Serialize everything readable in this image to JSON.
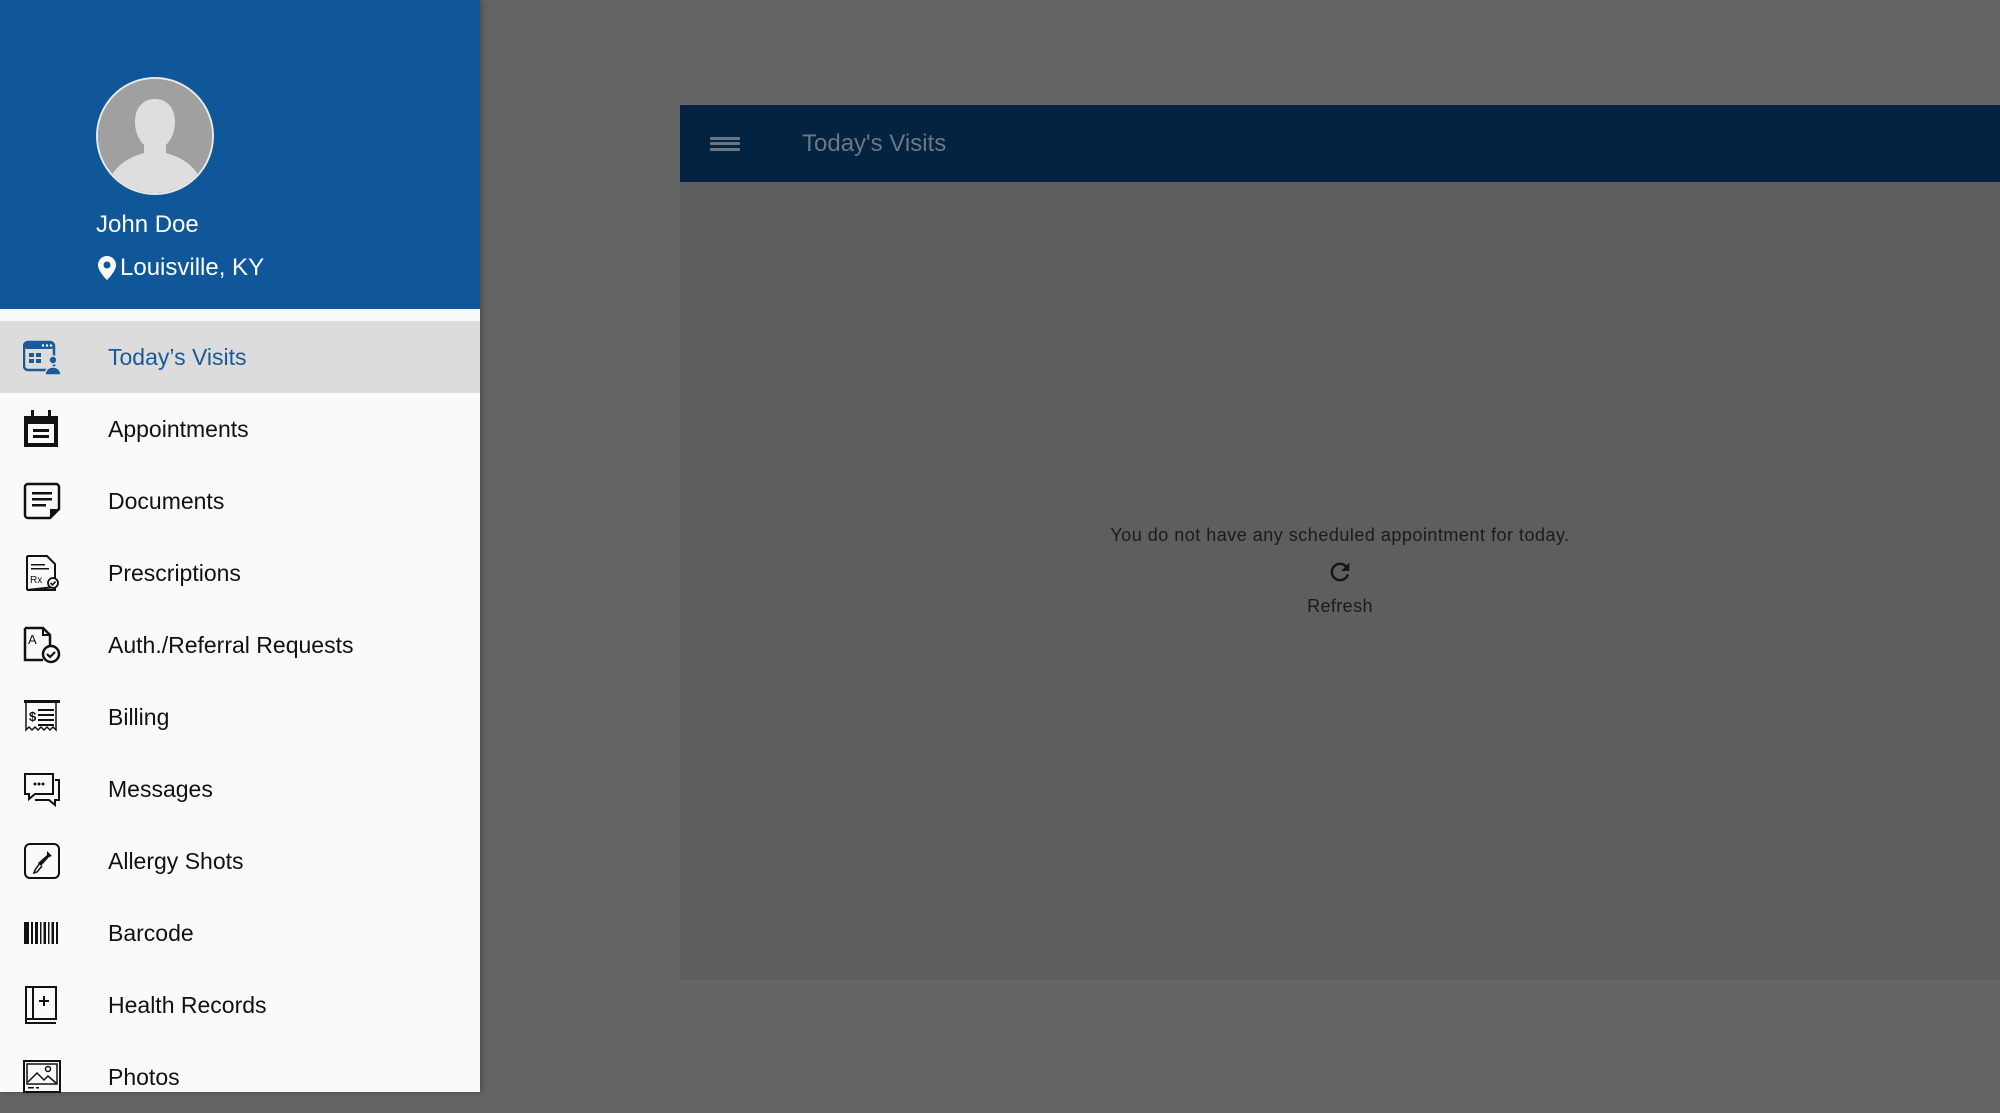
{
  "app_bar": {
    "title": "Today's Visits",
    "menu_icon": "hamburger-menu-icon"
  },
  "user": {
    "name": "John Doe",
    "location": "Louisville, KY",
    "avatar_icon": "default-user-avatar",
    "location_icon": "map-pin-icon"
  },
  "nav": {
    "items": [
      {
        "label": "Today’s Visits",
        "icon": "calendar-user-icon",
        "selected": true
      },
      {
        "label": "Appointments",
        "icon": "calendar-icon",
        "selected": false
      },
      {
        "label": "Documents",
        "icon": "document-icon",
        "selected": false
      },
      {
        "label": "Prescriptions",
        "icon": "prescription-icon",
        "selected": false
      },
      {
        "label": "Auth./Referral Requests",
        "icon": "auth-referral-icon",
        "selected": false
      },
      {
        "label": "Billing",
        "icon": "billing-receipt-icon",
        "selected": false
      },
      {
        "label": "Messages",
        "icon": "messages-icon",
        "selected": false
      },
      {
        "label": "Allergy Shots",
        "icon": "dropper-icon",
        "selected": false
      },
      {
        "label": "Barcode",
        "icon": "barcode-icon",
        "selected": false
      },
      {
        "label": "Health Records",
        "icon": "health-book-icon",
        "selected": false
      },
      {
        "label": "Photos",
        "icon": "photo-icon",
        "selected": false
      }
    ]
  },
  "main": {
    "empty_message": "You do not have any scheduled appointment for today.",
    "refresh_label": "Refresh",
    "refresh_icon": "refresh-icon"
  },
  "colors": {
    "drawer_header": "#0f5799",
    "selected_text": "#1a5a97",
    "app_bar": "#032340",
    "scrim_background": "#646464"
  }
}
